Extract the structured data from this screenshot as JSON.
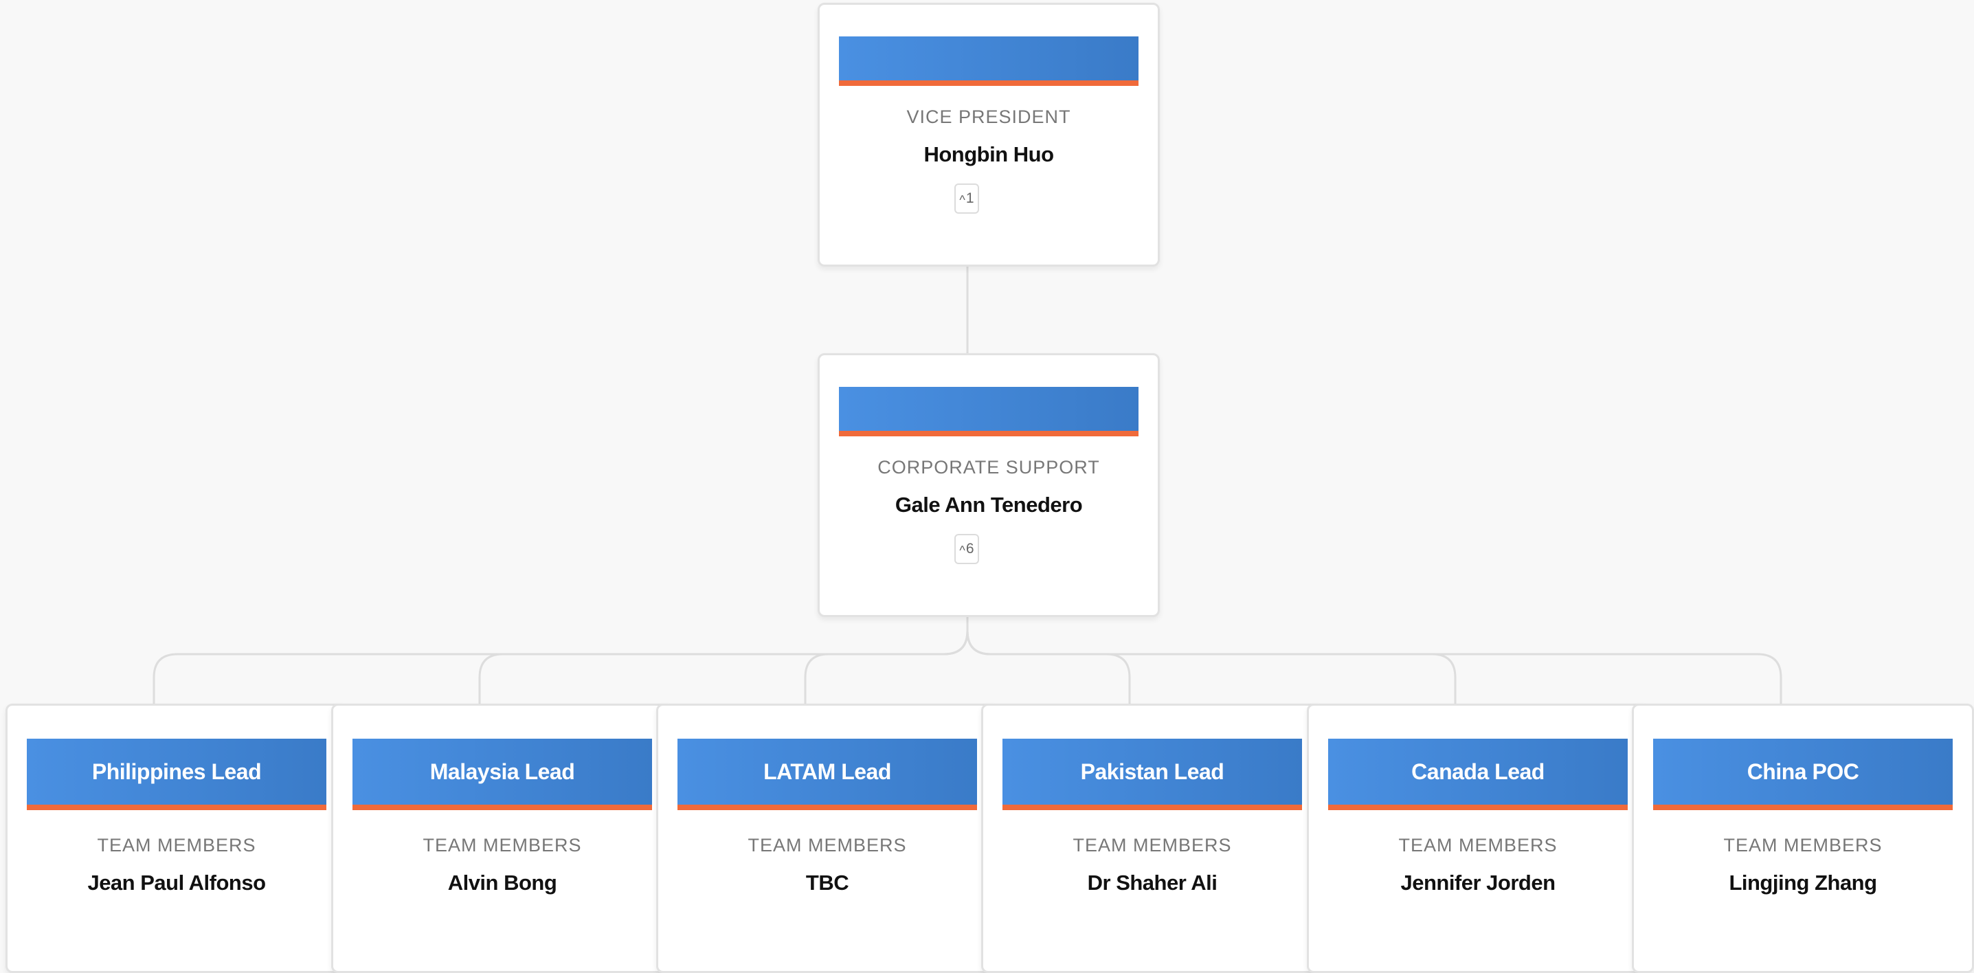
{
  "nodes": {
    "vice_president": {
      "role": "VICE PRESIDENT",
      "name": "Hongbin Huo",
      "children_count": "1"
    },
    "corporate_support": {
      "role": "CORPORATE SUPPORT",
      "name": "Gale Ann Tenedero",
      "children_count": "6"
    },
    "leaves": [
      {
        "title": "Philippines Lead",
        "role": "TEAM MEMBERS",
        "name": "Jean Paul Alfonso"
      },
      {
        "title": "Malaysia Lead",
        "role": "TEAM MEMBERS",
        "name": "Alvin Bong"
      },
      {
        "title": "LATAM Lead",
        "role": "TEAM MEMBERS",
        "name": "TBC"
      },
      {
        "title": "Pakistan Lead",
        "role": "TEAM MEMBERS",
        "name": "Dr Shaher Ali"
      },
      {
        "title": "Canada Lead",
        "role": "TEAM MEMBERS",
        "name": "Jennifer Jorden"
      },
      {
        "title": "China POC",
        "role": "TEAM MEMBERS",
        "name": "Lingjing Zhang"
      }
    ]
  },
  "colors": {
    "banner": "#4a90e2",
    "banner_dark": "#3a7bc8",
    "accent": "#f06a3a",
    "connector": "#dddddd",
    "background": "#f8f8f8"
  },
  "icons": {
    "toggle": "chevron-up-icon"
  }
}
